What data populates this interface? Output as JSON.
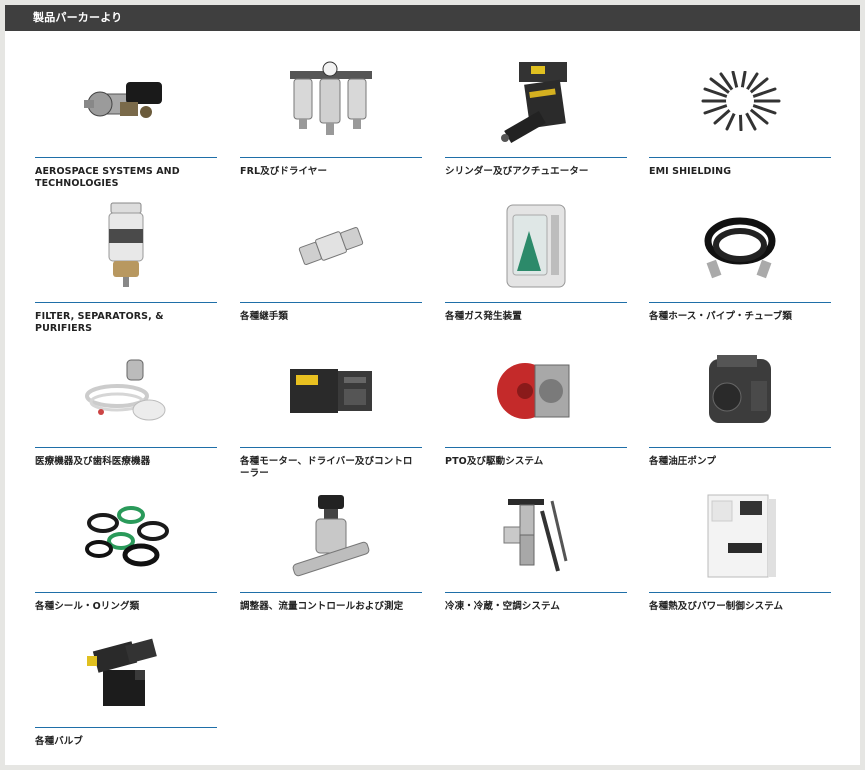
{
  "section": {
    "title": "製品パーカーより"
  },
  "products": [
    {
      "label": "AEROSPACE SYSTEMS AND TECHNOLOGIES",
      "icon": "aerospace-valve-icon"
    },
    {
      "label": "FRL及びドライヤー",
      "icon": "frl-unit-icon"
    },
    {
      "label": "シリンダー及びアクチュエーター",
      "icon": "actuator-icon"
    },
    {
      "label": "EMI SHIELDING",
      "icon": "emi-shielding-icon"
    },
    {
      "label": "FILTER, SEPARATORS, & PURIFIERS",
      "icon": "filter-separator-icon"
    },
    {
      "label": "各種継手類",
      "icon": "fitting-icon"
    },
    {
      "label": "各種ガス発生装置",
      "icon": "gas-generator-icon"
    },
    {
      "label": "各種ホース・パイプ・チューブ類",
      "icon": "hose-icon"
    },
    {
      "label": "医療機器及び歯科医療機器",
      "icon": "medical-device-icon"
    },
    {
      "label": "各種モーター、ドライバー及びコントローラー",
      "icon": "motor-driver-icon"
    },
    {
      "label": "PTO及び駆動システム",
      "icon": "pto-drive-icon"
    },
    {
      "label": "各種油圧ポンプ",
      "icon": "hydraulic-pump-icon"
    },
    {
      "label": "各種シール・Oリング類",
      "icon": "o-ring-icon"
    },
    {
      "label": "調整器、流量コントロールおよび測定",
      "icon": "regulator-icon"
    },
    {
      "label": "冷凍・冷蔵・空調システム",
      "icon": "refrigeration-valve-icon"
    },
    {
      "label": "各種熱及びパワー制御システム",
      "icon": "chiller-icon"
    },
    {
      "label": "各種バルブ",
      "icon": "valve-icon"
    }
  ]
}
